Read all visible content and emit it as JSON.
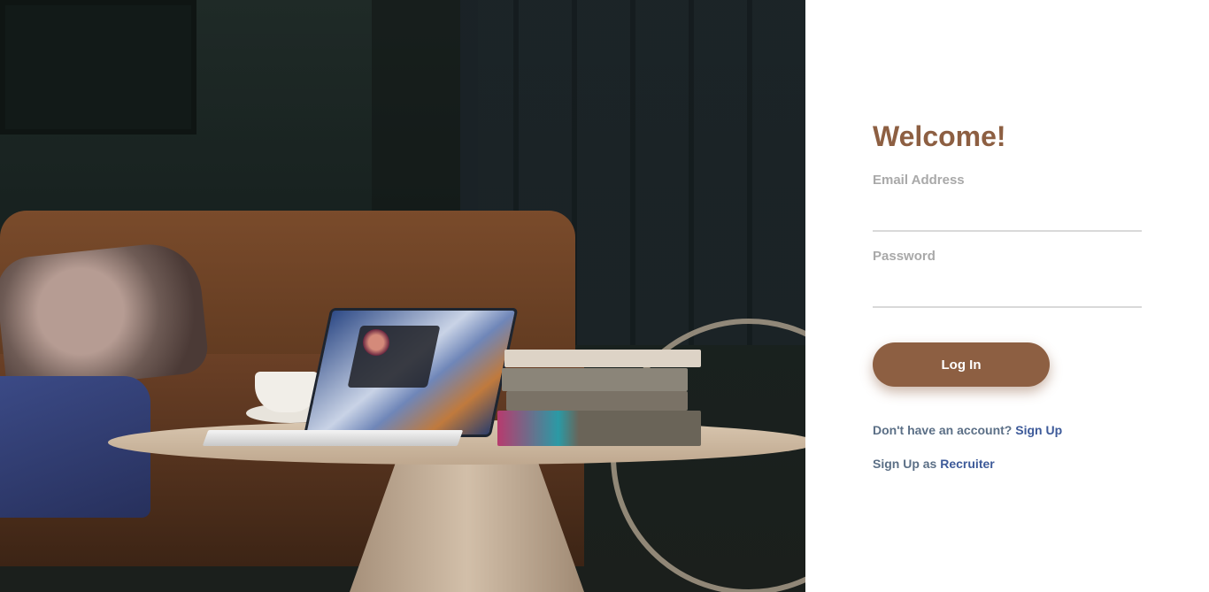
{
  "login": {
    "title": "Welcome!",
    "email_label": "Email Address",
    "email_value": "",
    "password_label": "Password",
    "password_value": "",
    "login_button": "Log In",
    "signup_prompt": "Don't have an account?",
    "signup_link": "Sign Up",
    "recruiter_prefix": "Sign Up as",
    "recruiter_link": "Recruiter"
  },
  "colors": {
    "accent": "#8d5f42",
    "label": "#a9a9a9",
    "link": "#3d5a99"
  }
}
